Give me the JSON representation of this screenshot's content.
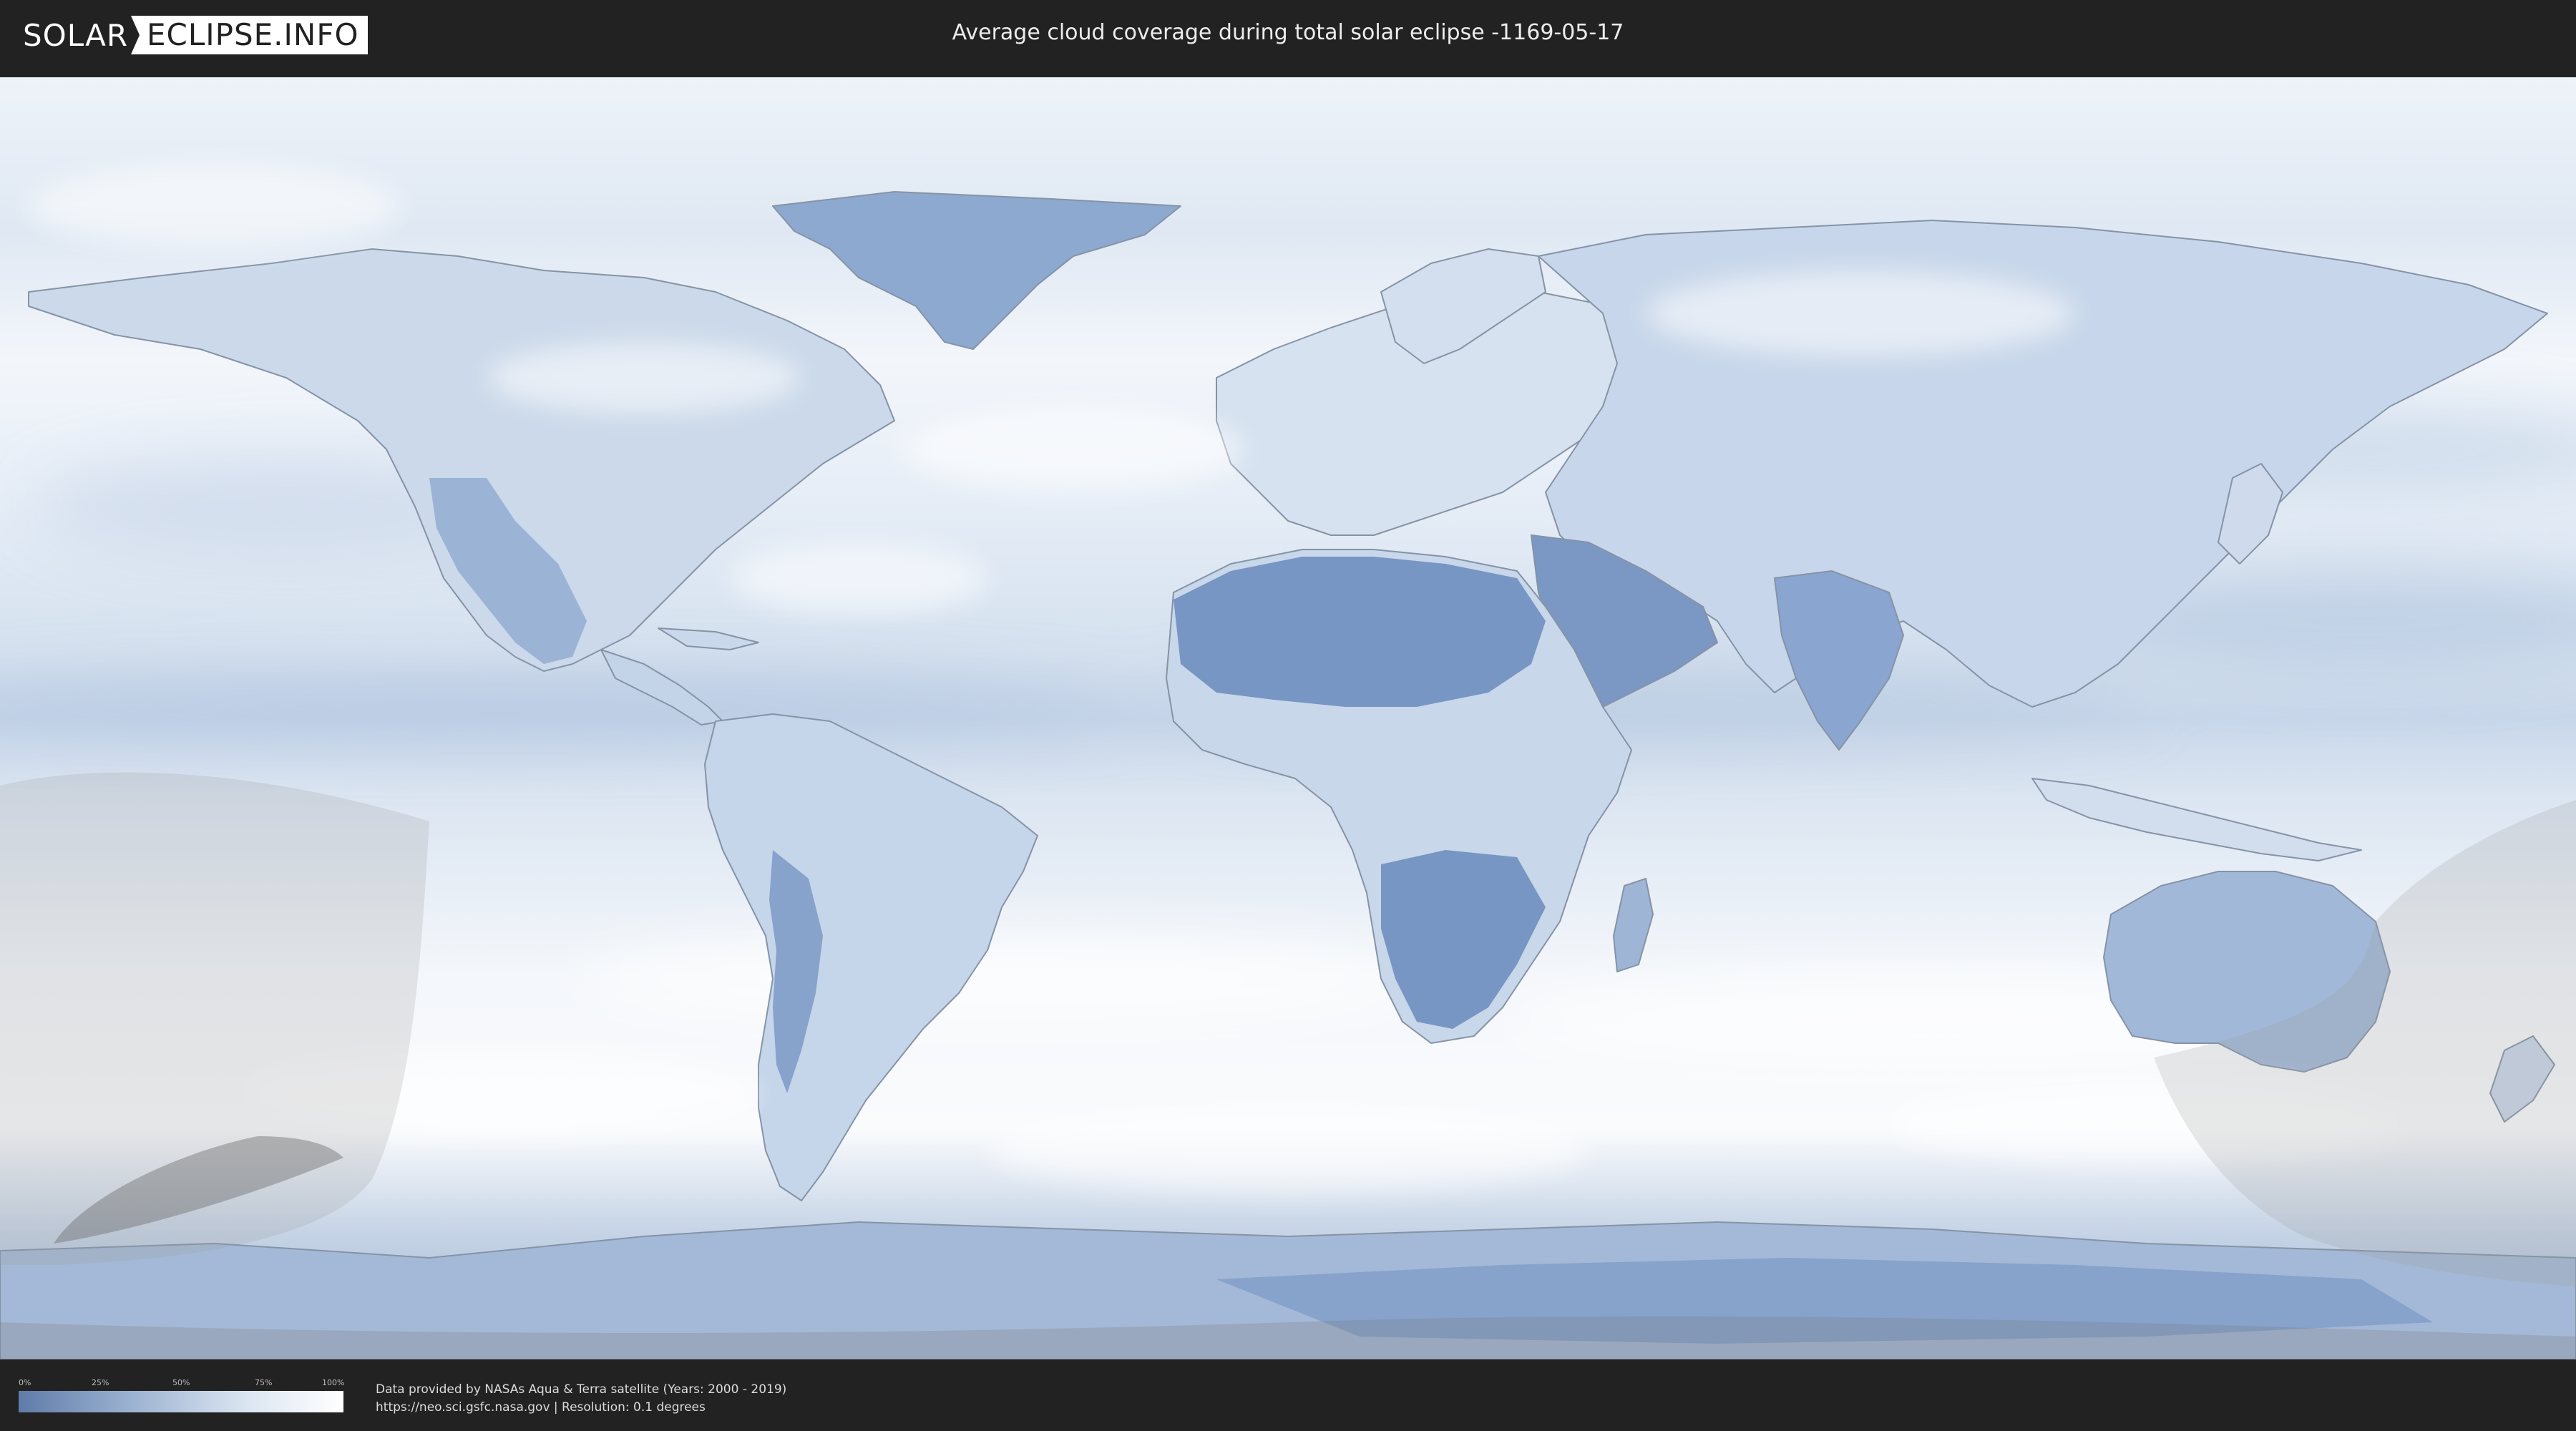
{
  "header": {
    "logo_part1": "SOLAR",
    "logo_part2": "ECLIPSE.INFO",
    "title": "Average cloud coverage during total solar eclipse -1169-05-17"
  },
  "map": {
    "ocean_color": "#e8eef6",
    "cloud_light_color": "#f7f9fc",
    "low_cloud_color": "#6e8fc0",
    "coast_color": "#8a97a8",
    "shadow_color": "#9a9a9a"
  },
  "legend": {
    "ticks": [
      "0%",
      "25%",
      "50%",
      "75%",
      "100%"
    ],
    "gradient_start": "#5f7ba9",
    "gradient_end": "#ffffff"
  },
  "credits": {
    "line1": "Data provided by NASAs Aqua & Terra satellite (Years: 2000 - 2019)",
    "line2": "https://neo.sci.gsfc.nasa.gov | Resolution: 0.1 degrees"
  }
}
